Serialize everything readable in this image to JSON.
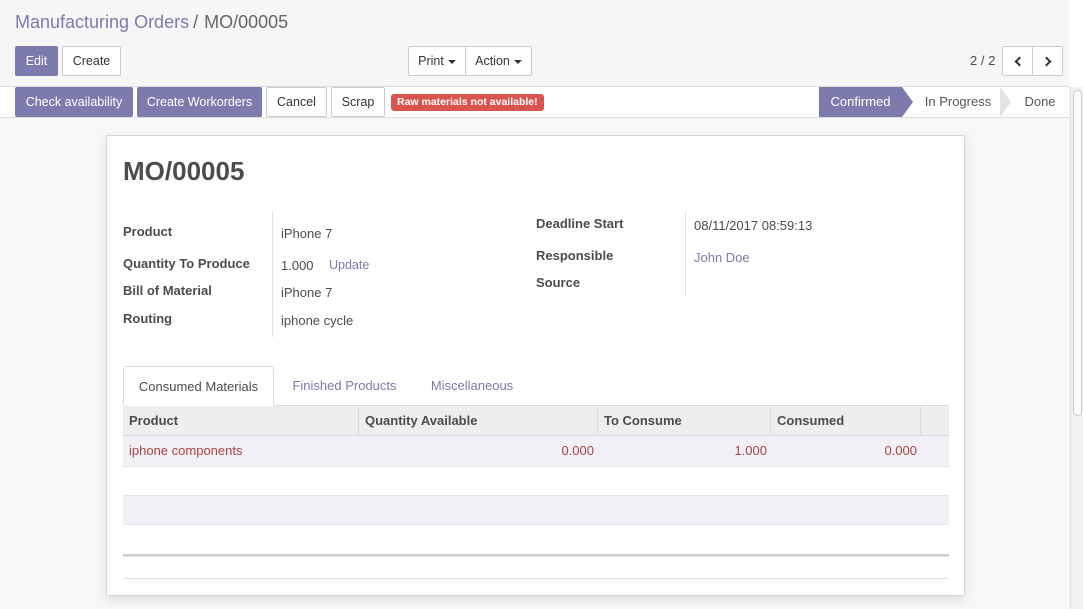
{
  "breadcrumb": {
    "parent": "Manufacturing Orders",
    "separator": "/",
    "current": "MO/00005"
  },
  "toolbar": {
    "edit": "Edit",
    "create": "Create",
    "print": "Print",
    "action": "Action"
  },
  "pager": {
    "value": "2 / 2"
  },
  "statusbar": {
    "check_availability": "Check availability",
    "create_workorders": "Create Workorders",
    "cancel": "Cancel",
    "scrap": "Scrap",
    "warning": "Raw materials not available!",
    "stages": [
      "Confirmed",
      "In Progress",
      "Done"
    ],
    "active_stage": "Confirmed"
  },
  "form": {
    "title": "MO/00005",
    "product_label": "Product",
    "product_value": "iPhone 7",
    "qty_label": "Quantity To Produce",
    "qty_value": "1.000",
    "qty_update": "Update",
    "bom_label": "Bill of Material",
    "bom_value": "iPhone 7",
    "routing_label": "Routing",
    "routing_value": "iphone cycle",
    "deadline_label": "Deadline Start",
    "deadline_value": "08/11/2017 08:59:13",
    "responsible_label": "Responsible",
    "responsible_value": "John Doe",
    "source_label": "Source"
  },
  "tabs": [
    "Consumed Materials",
    "Finished Products",
    "Miscellaneous"
  ],
  "table": {
    "headers": [
      "Product",
      "Quantity Available",
      "To Consume",
      "Consumed"
    ],
    "rows": [
      {
        "product": "iphone components",
        "available": "0.000",
        "to_consume": "1.000",
        "consumed": "0.000"
      }
    ]
  },
  "colors": {
    "brand": "#7c7bad",
    "danger": "#d9534f",
    "warning_text": "#a94442"
  }
}
